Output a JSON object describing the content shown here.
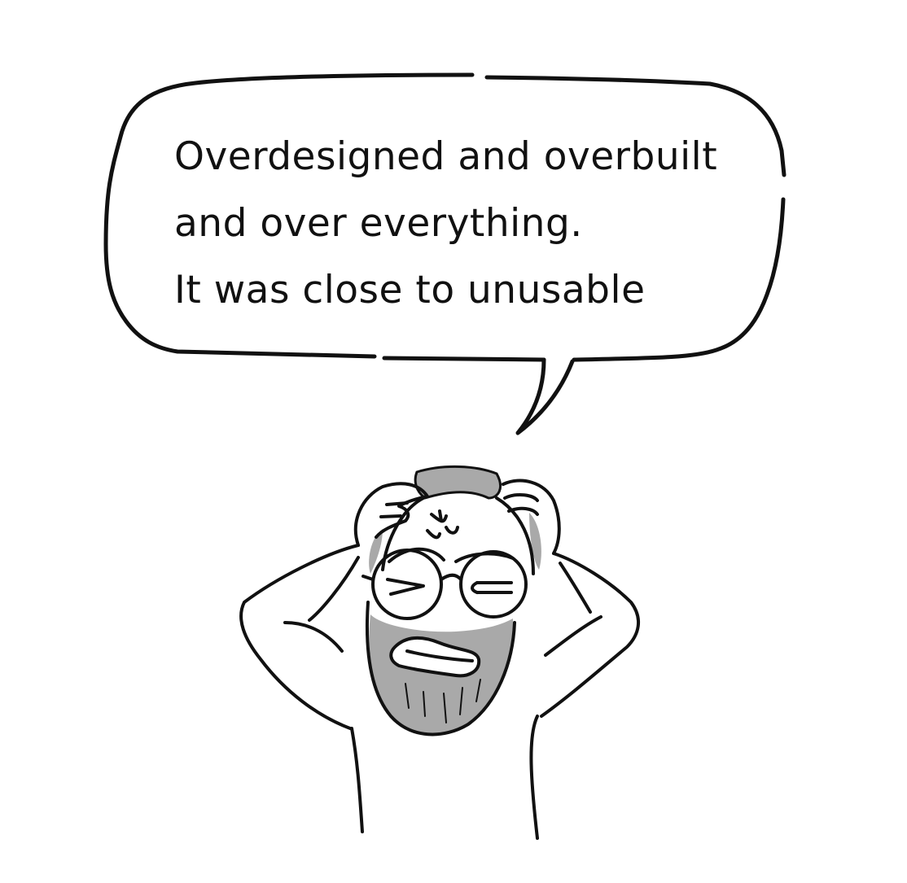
{
  "speech_bubble": {
    "lines": [
      "Overdesigned and overbuilt",
      "and over everything.",
      "It was close to unusable"
    ]
  },
  "illustration": {
    "subject": "frustrated-man-with-glasses-and-beard",
    "colors": {
      "ink": "#111111",
      "hair_and_beard": "#a9a9a9",
      "background": "#ffffff"
    }
  }
}
